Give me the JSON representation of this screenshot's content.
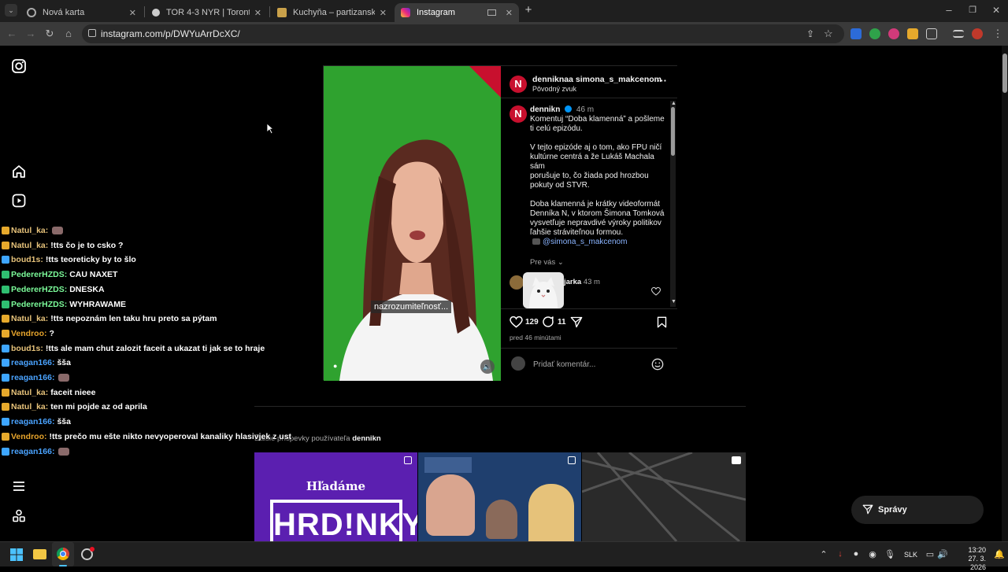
{
  "browser": {
    "tabs": [
      {
        "title": "Nová karta",
        "active": false
      },
      {
        "title": "TOR 4-3 NYR | Toronto Maple L",
        "active": false
      },
      {
        "title": "Kuchyňa – partizanske.penzion",
        "active": false
      },
      {
        "title": "Instagram",
        "active": true
      }
    ],
    "url": "instagram.com/p/DWYuArrDcXC/"
  },
  "post": {
    "header_user": "denniknaa simona_s_makcenom",
    "header_sub": "Pôvodný zvuk",
    "author": "dennikn",
    "time": "46 m",
    "caption": [
      "Komentuj “Doba klamenná” a pošleme",
      "ti celú epizódu.",
      "",
      "V tejto epizóde aj o tom, ako FPU ničí",
      "kultúrne centrá a že Lukáš Machala sám",
      "porušuje to, čo žiada pod hrozbou",
      "pokuty od STVR.",
      "",
      "Doba klamenná je krátky videoformát",
      "Denníka N, v ktorom Šimona Tomková",
      "vysvetľuje nepravdivé výroky politikov",
      "ľahšie stráviteľnou formou."
    ],
    "mention": "@simona_s_makcenom",
    "pre_vas": "Pre vás",
    "comment_user": "jarka",
    "comment_time": "43 m",
    "likes": "129",
    "comments": "11",
    "posted": "pred 46 minútami",
    "add_comment_placeholder": "Pridať komentár...",
    "subtitle": "nazrozumiteľnosť..."
  },
  "more_posts": {
    "prefix": "Ďalšie príspevky používateľa",
    "user": "dennikn",
    "tile1_title": "Hľadáme",
    "tile1_big": "HRD!NKY"
  },
  "messages_button": "Správy",
  "chat": [
    {
      "user": "Natul_ka",
      "msg": "",
      "color": "#e6c27a",
      "emote": true
    },
    {
      "user": "Natul_ka",
      "msg": "!tts čo je to csko ?",
      "color": "#e6c27a",
      "emote": false
    },
    {
      "user": "boud1s",
      "msg": "!tts teoreticky by to šlo",
      "color": "#e6c27a",
      "emote": false
    },
    {
      "user": "PedererHZDS",
      "msg": "CAU NAXET",
      "color": "#7cfc9a",
      "emote": false
    },
    {
      "user": "PedererHZDS",
      "msg": "DNESKA",
      "color": "#7cfc9a",
      "emote": false
    },
    {
      "user": "PedererHZDS",
      "msg": "WYHRAWAME",
      "color": "#7cfc9a",
      "emote": false
    },
    {
      "user": "Natul_ka",
      "msg": "!tts nepoznám len taku hru preto sa pýtam",
      "color": "#e6c27a",
      "emote": false
    },
    {
      "user": "Vendroo",
      "msg": "?",
      "color": "#e8a52c",
      "emote": false
    },
    {
      "user": "boud1s",
      "msg": "!tts ale mam chut zalozit faceit a ukazat ti jak se to hraje",
      "color": "#e6c27a",
      "emote": false
    },
    {
      "user": "reagan166",
      "msg": "šša",
      "color": "#4aa3ff",
      "emote": false
    },
    {
      "user": "reagan166",
      "msg": "",
      "color": "#4aa3ff",
      "emote": true
    },
    {
      "user": "Natul_ka",
      "msg": "faceit nieee",
      "color": "#e6c27a",
      "emote": false
    },
    {
      "user": "Natul_ka",
      "msg": "ten mi pojde az od aprila",
      "color": "#e6c27a",
      "emote": false
    },
    {
      "user": "reagan166",
      "msg": "šša",
      "color": "#4aa3ff",
      "emote": false
    },
    {
      "user": "Vendroo",
      "msg": "!tts prečo mu ešte nikto nevyoperoval kanaliky hlasivjek z ust",
      "color": "#e8a52c",
      "emote": false
    },
    {
      "user": "reagan166",
      "msg": "",
      "color": "#4aa3ff",
      "emote": true
    }
  ],
  "taskbar": {
    "lang": "SLK",
    "time": "13:20",
    "date": "27. 3. 2026"
  },
  "colors": {
    "green_screen": "#2fa22f",
    "instagram_accent": "#0095f6",
    "dennikn_red": "#c8102e"
  }
}
